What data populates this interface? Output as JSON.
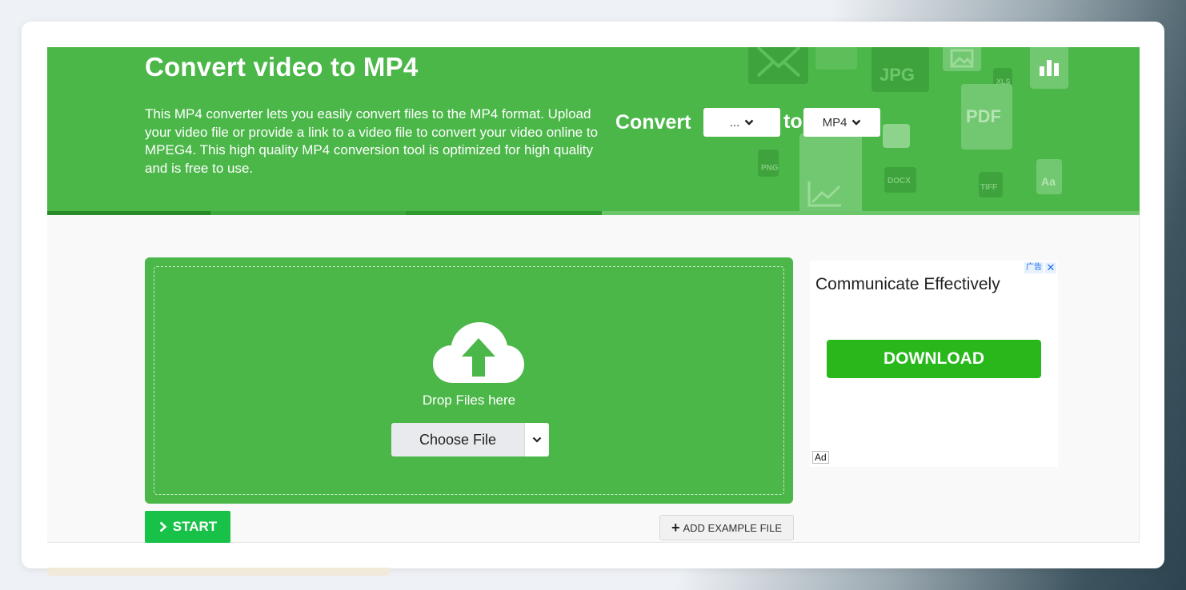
{
  "hero": {
    "title": "Convert video to MP4",
    "description": "This MP4 converter lets you easily convert files to the MP4 format. Upload your video file or provide a link to a video file to convert your video online to MPEG4. This high quality MP4 conversion tool is optimized for high quality and is free to use.",
    "convert_label": "Convert",
    "to_label": "to",
    "from_select_value": "...",
    "to_select_value": "MP4",
    "decor_labels": [
      "JPG",
      "PDF",
      "XLS",
      "PNG",
      "DOCX",
      "TIFF",
      "Aa"
    ]
  },
  "upload": {
    "drop_label": "Drop Files here",
    "choose_label": "Choose File"
  },
  "actions": {
    "start_label": "START",
    "add_example_label": "ADD EXAMPLE FILE"
  },
  "ad": {
    "choice_tag": "广告",
    "close_glyph": "✕",
    "headline": "Communicate Effectively",
    "button_label": "DOWNLOAD",
    "ad_label": "Ad"
  },
  "colors": {
    "brand_green": "#4bb749",
    "start_green": "#18c248",
    "ad_button_green": "#28b81c"
  }
}
